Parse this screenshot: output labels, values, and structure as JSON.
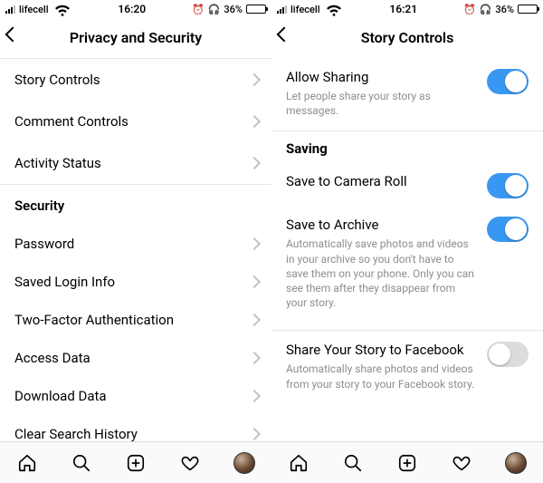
{
  "left": {
    "status": {
      "carrier": "lifecell",
      "time": "16:20",
      "battery_pct": "36%"
    },
    "header": {
      "title": "Privacy and Security"
    },
    "items_top": [
      {
        "label": "Story Controls"
      },
      {
        "label": "Comment Controls"
      },
      {
        "label": "Activity Status"
      }
    ],
    "section": "Security",
    "items_bottom": [
      {
        "label": "Password"
      },
      {
        "label": "Saved Login Info"
      },
      {
        "label": "Two-Factor Authentication"
      },
      {
        "label": "Access Data"
      },
      {
        "label": "Download Data"
      },
      {
        "label": "Clear Search History"
      }
    ]
  },
  "right": {
    "status": {
      "carrier": "lifecell",
      "time": "16:21",
      "battery_pct": "36%"
    },
    "header": {
      "title": "Story Controls"
    },
    "allow_sharing": {
      "title": "Allow Sharing",
      "desc": "Let people share your story as messages.",
      "on": true
    },
    "saving_header": "Saving",
    "save_camera_roll": {
      "title": "Save to Camera Roll",
      "on": true
    },
    "save_archive": {
      "title": "Save to Archive",
      "desc": "Automatically save photos and videos in your archive so you don't have to save them on your phone. Only you can see them after they disappear from your story.",
      "on": true
    },
    "share_fb": {
      "title": "Share Your Story to Facebook",
      "desc": "Automatically share photos and videos from your story to your Facebook story.",
      "on": false
    }
  }
}
